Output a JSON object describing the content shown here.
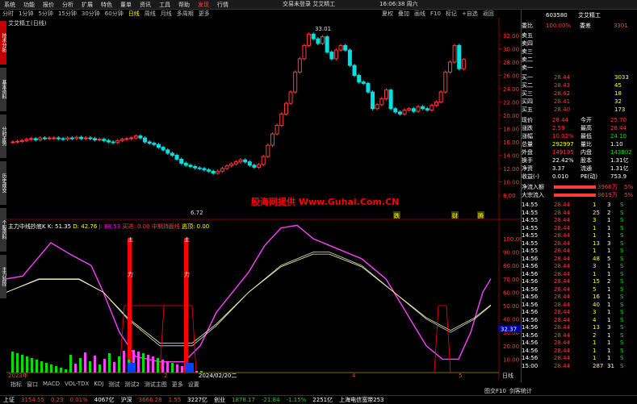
{
  "menubar": {
    "items": [
      {
        "label": "系统",
        "hl": false
      },
      {
        "label": "功能",
        "hl": false
      },
      {
        "label": "报价",
        "hl": false
      },
      {
        "label": "分析",
        "hl": false
      },
      {
        "label": "扩展",
        "hl": false
      },
      {
        "label": "特色",
        "hl": false
      },
      {
        "label": "董单",
        "hl": false
      },
      {
        "label": "资讯",
        "hl": false
      },
      {
        "label": "工具",
        "hl": false
      },
      {
        "label": "帮助",
        "hl": false
      },
      {
        "label": "发现",
        "hl": true
      },
      {
        "label": "行情",
        "hl": false
      }
    ],
    "window_title": "交易未登录 艾艾精工",
    "clock": "16:06:38 周六"
  },
  "period_tabs": [
    {
      "label": "分时",
      "active": false
    },
    {
      "label": "1分钟",
      "active": false
    },
    {
      "label": "5分钟",
      "active": false
    },
    {
      "label": "15分钟",
      "active": false
    },
    {
      "label": "30分钟",
      "active": false
    },
    {
      "label": "60分钟",
      "active": false
    },
    {
      "label": "日线",
      "active": true
    },
    {
      "label": "周线",
      "active": false
    },
    {
      "label": "月线",
      "active": false
    },
    {
      "label": "多周期",
      "active": false
    },
    {
      "label": "更多",
      "active": false
    }
  ],
  "toolbar_right": [
    "夏权",
    "叠加",
    "画线",
    "F10",
    "标记",
    "+自选",
    "返回"
  ],
  "left_tabs": [
    "技术分析",
    "基本资料",
    "分时走势",
    "历史成交",
    "个股资料",
    "主力监控"
  ],
  "chart": {
    "title": "艾艾精工(日线)",
    "price_axis": [
      "32.00",
      "30.00",
      "28.00",
      "26.00",
      "24.00",
      "22.00",
      "20.00",
      "18.00",
      "16.00",
      "14.00",
      "12.00",
      "10.00",
      "8.00"
    ],
    "high_label": "33.01",
    "low_label": "6.72",
    "watermark": "股海网提供 Www.Guhai.Com.CN",
    "markers": [
      "跌",
      "财",
      "腾"
    ]
  },
  "indicator": {
    "name": "主力中线抄底K",
    "K": "K: 51.35",
    "D": "D: 42.76",
    "J": "J: 68.53",
    "extra1": "买进: 0.00",
    "extra2": "中期持股线",
    "extra3": "逃顶: 0.00",
    "axis": [
      "100.00",
      "90.00",
      "80.00",
      "70.00",
      "60.00",
      "50.00",
      "40.00",
      "30.00",
      "20.00",
      "10.00"
    ],
    "current": "32.37",
    "vertical_labels": [
      "主",
      "力",
      "主",
      "力"
    ]
  },
  "bottom_tabs": [
    "指标",
    "窗口",
    "MACD",
    "VOL-TDX",
    "KDJ",
    "测试",
    "测试2",
    "测试主图",
    "更多",
    "设置"
  ],
  "time_axis": {
    "start": "2023年",
    "marks": [
      "2",
      "2024/02/20二",
      "4",
      "5"
    ],
    "end": "日线"
  },
  "status_right": [
    "图交F10",
    "剑客统计"
  ],
  "panel": {
    "code": "603580",
    "name": "艾艾精工",
    "webi_label": "委比",
    "webi_val": "100.00%",
    "weicha_label": "委差",
    "weicha_val": "3301",
    "sells": [
      {
        "label": "卖五",
        "price": "",
        "vol": ""
      },
      {
        "label": "卖四",
        "price": "",
        "vol": ""
      },
      {
        "label": "卖三",
        "price": "",
        "vol": ""
      },
      {
        "label": "卖二",
        "price": "",
        "vol": ""
      },
      {
        "label": "卖一",
        "price": "",
        "vol": ""
      }
    ],
    "buys": [
      {
        "label": "买一",
        "price": "28.44",
        "vol": "3033"
      },
      {
        "label": "买二",
        "price": "28.43",
        "vol": "45"
      },
      {
        "label": "买三",
        "price": "28.42",
        "vol": "18"
      },
      {
        "label": "买四",
        "price": "28.41",
        "vol": "32"
      },
      {
        "label": "买五",
        "price": "28.40",
        "vol": "173"
      }
    ],
    "stats": [
      {
        "l1": "现价",
        "v1": "28.44",
        "l2": "今开",
        "v2": "25.70"
      },
      {
        "l1": "涨跌",
        "v1": "2.59",
        "l2": "最高",
        "v2": "28.44"
      },
      {
        "l1": "涨幅",
        "v1": "10.02%",
        "l2": "最低",
        "v2": "24.10"
      },
      {
        "l1": "总量",
        "v1": "292997",
        "l2": "量比",
        "v2": "1.10"
      },
      {
        "l1": "外盘",
        "v1": "149195",
        "l2": "内盘",
        "v2": "143802"
      },
      {
        "l1": "换手",
        "v1": "22.42%",
        "l2": "股本",
        "v2": "1.31亿"
      },
      {
        "l1": "净资",
        "v1": "3.37",
        "l2": "流通",
        "v2": "1.31亿"
      },
      {
        "l1": "收益(-)",
        "v1": "0.010",
        "l2": "PE(动)",
        "v2": "753.9"
      }
    ],
    "flows": [
      {
        "label": "净流入额",
        "val": "3966万",
        "pct": "5%"
      },
      {
        "label": "大宗流入",
        "val": "3619万",
        "pct": "5%"
      }
    ],
    "ticks": [
      {
        "t": "14:55",
        "p": "28.44",
        "v": "1",
        "n": "3",
        "d": "S"
      },
      {
        "t": "14:55",
        "p": "28.44",
        "v": "25",
        "n": "2",
        "d": "S"
      },
      {
        "t": "14:55",
        "p": "28.44",
        "v": "3",
        "n": "1",
        "d": "S"
      },
      {
        "t": "14:55",
        "p": "28.44",
        "v": "1",
        "n": "1",
        "d": "S"
      },
      {
        "t": "14:55",
        "p": "28.44",
        "v": "1",
        "n": "1",
        "d": "S"
      },
      {
        "t": "14:55",
        "p": "28.44",
        "v": "13",
        "n": "3",
        "d": "S"
      },
      {
        "t": "14:55",
        "p": "28.44",
        "v": "1",
        "n": "1",
        "d": "S"
      },
      {
        "t": "14:56",
        "p": "28.44",
        "v": "48",
        "n": "5",
        "d": "S"
      },
      {
        "t": "14:56",
        "p": "28.44",
        "v": "3",
        "n": "1",
        "d": "S"
      },
      {
        "t": "14:56",
        "p": "28.44",
        "v": "1",
        "n": "1",
        "d": "S"
      },
      {
        "t": "14:56",
        "p": "28.44",
        "v": "15",
        "n": "2",
        "d": "S"
      },
      {
        "t": "14:56",
        "p": "28.44",
        "v": "5",
        "n": "1",
        "d": "S"
      },
      {
        "t": "14:56",
        "p": "28.44",
        "v": "16",
        "n": "1",
        "d": "S"
      },
      {
        "t": "14:56",
        "p": "28.44",
        "v": "40",
        "n": "1",
        "d": "S"
      },
      {
        "t": "14:56",
        "p": "28.44",
        "v": "3",
        "n": "1",
        "d": "S"
      },
      {
        "t": "14:56",
        "p": "28.44",
        "v": "4",
        "n": "1",
        "d": "S"
      },
      {
        "t": "14:56",
        "p": "28.44",
        "v": "13",
        "n": "3",
        "d": "S"
      },
      {
        "t": "14:56",
        "p": "28.44",
        "v": "2",
        "n": "1",
        "d": "S"
      },
      {
        "t": "14:56",
        "p": "28.44",
        "v": "1",
        "n": "1",
        "d": "S"
      },
      {
        "t": "14:56",
        "p": "28.44",
        "v": "1",
        "n": "1",
        "d": "S"
      },
      {
        "t": "14:56",
        "p": "28.44",
        "v": "1",
        "n": "1",
        "d": "S"
      },
      {
        "t": "15:00",
        "p": "28.44",
        "v": "287",
        "n": "31",
        "d": "S"
      }
    ]
  },
  "statusbar": [
    {
      "text": "上证",
      "cls": "white"
    },
    {
      "text": "3154.55",
      "cls": "red"
    },
    {
      "text": "0.23",
      "cls": "red"
    },
    {
      "text": "0.01%",
      "cls": "red"
    },
    {
      "text": "4067亿",
      "cls": "white"
    },
    {
      "text": "沪深",
      "cls": "white"
    },
    {
      "text": "3666.28",
      "cls": "red"
    },
    {
      "text": "1.55",
      "cls": "red"
    },
    {
      "text": "3227亿",
      "cls": "white"
    },
    {
      "text": "创业",
      "cls": "white"
    },
    {
      "text": "1878.17",
      "cls": "green"
    },
    {
      "text": "-21.84",
      "cls": "green"
    },
    {
      "text": "-1.15%",
      "cls": "green"
    },
    {
      "text": "2251亿",
      "cls": "white"
    },
    {
      "text": "上海电信宽带253",
      "cls": "white"
    }
  ],
  "colors": {
    "up": "#ff3b3b",
    "down": "#00e0e0",
    "kline_k": "#e0e0e0",
    "kline_d": "#ffff99",
    "j": "#ff40ff",
    "grid": "#660000"
  }
}
